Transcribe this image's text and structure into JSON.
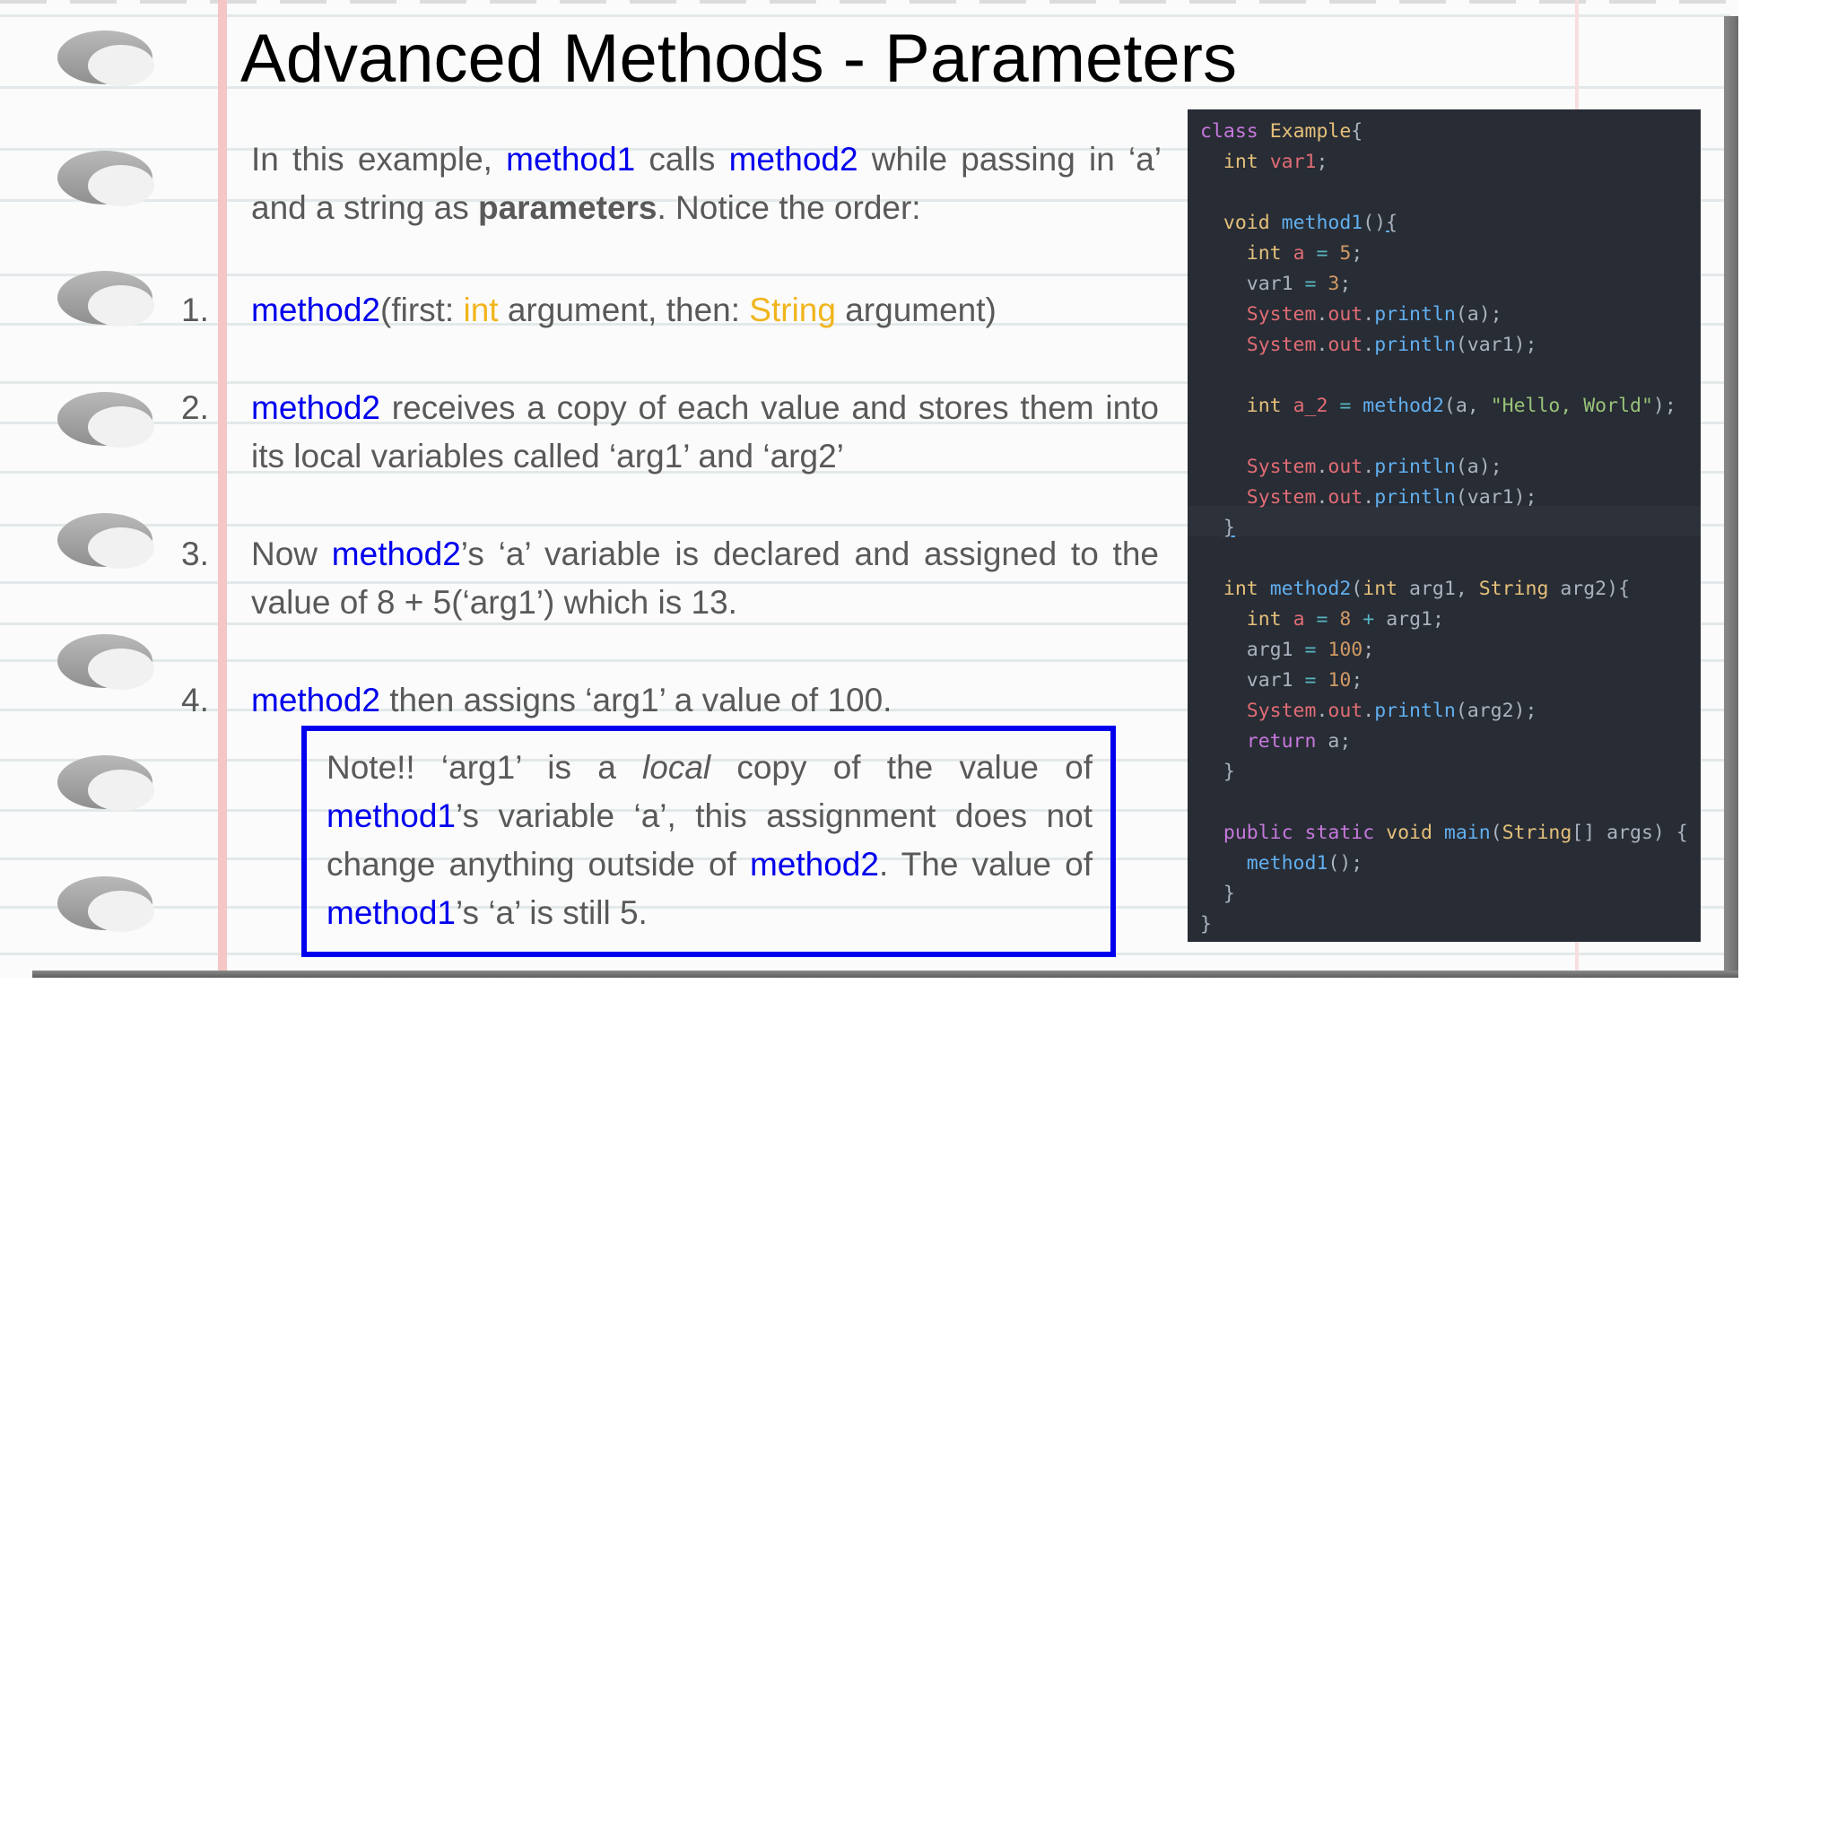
{
  "title": "Advanced Methods - Parameters",
  "intro": {
    "t1": "In this example, ",
    "m1": "method1",
    "t2": " calls ",
    "m2": "method2",
    "t3": " while passing in ‘a’ and a string as ",
    "bold": "parameters",
    "t4": ". Notice the order:"
  },
  "items": [
    {
      "num": "1.",
      "m": "method2",
      "a": "(first: ",
      "y1": "int",
      "b": " argument, then: ",
      "y2": "String",
      "c": " argument)"
    },
    {
      "num": "2.",
      "m": "method2",
      "a": " receives a copy of each value and stores them into its local variables called ‘arg1’ and ‘arg2’"
    },
    {
      "num": "3.",
      "t": "Now ",
      "m": "method2",
      "a": "’s ‘a’ variable is declared and assigned to the value of 8 + 5(‘arg1’) which is 13."
    },
    {
      "num": "4.",
      "m": "method2",
      "a": " then assigns ‘arg1’ a value of 100."
    }
  ],
  "note": {
    "t1": "Note!! ‘arg1’ is a ",
    "em": "local",
    "t2": " copy of the value of ",
    "m1": "method1",
    "t3": "’s variable ‘a’, this assignment does not change anything outside of ",
    "m2": "method2",
    "t4": ". The value of ",
    "m3": "method1",
    "t5": "’s ‘a’ is still 5."
  },
  "code": {
    "class_kw": "class",
    "class_name": "Example",
    "int": "int",
    "void": "void",
    "public": "public",
    "static": "static",
    "return": "return",
    "String": "String",
    "var1": "var1",
    "a": "a",
    "a_2": "a_2",
    "arg1": "arg1",
    "arg2": "arg2",
    "args": "args",
    "method1": "method1",
    "method2": "method2",
    "main": "main",
    "System": "System",
    "out": "out",
    "println": "println",
    "n5": "5",
    "n3": "3",
    "n8": "8",
    "n100": "100",
    "n10": "10",
    "hello": "\"Hello, World\""
  },
  "colors": {
    "link_blue": "#0000ee",
    "type_yellow": "#f1b51c",
    "body_text": "#595959",
    "code_bg": "#282c34"
  }
}
